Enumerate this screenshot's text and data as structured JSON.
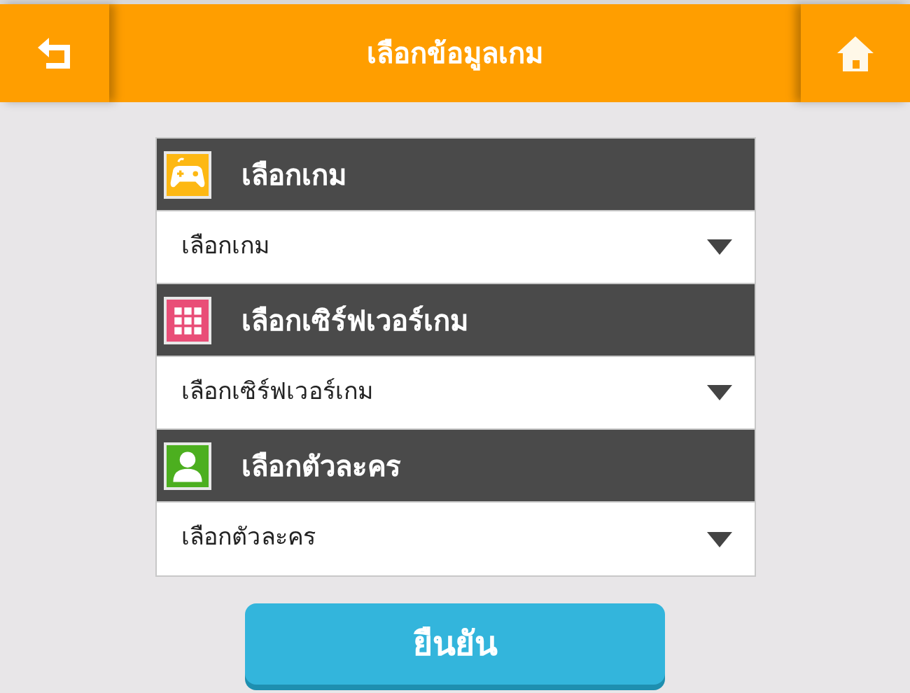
{
  "header": {
    "title": "เลือกข้อมูลเกม"
  },
  "sections": [
    {
      "kind": "gamepad",
      "color": "#fdb813",
      "title": "เลือกเกม",
      "placeholder": "เลือกเกม"
    },
    {
      "kind": "grid",
      "color": "#e94e77",
      "title": "เลือกเซิร์ฟเวอร์เกม",
      "placeholder": "เลือกเซิร์ฟเวอร์เกม"
    },
    {
      "kind": "person",
      "color": "#4caf1f",
      "title": "เลือกตัวละคร",
      "placeholder": "เลือกตัวละคร"
    }
  ],
  "confirm_button": "ยืนยัน"
}
